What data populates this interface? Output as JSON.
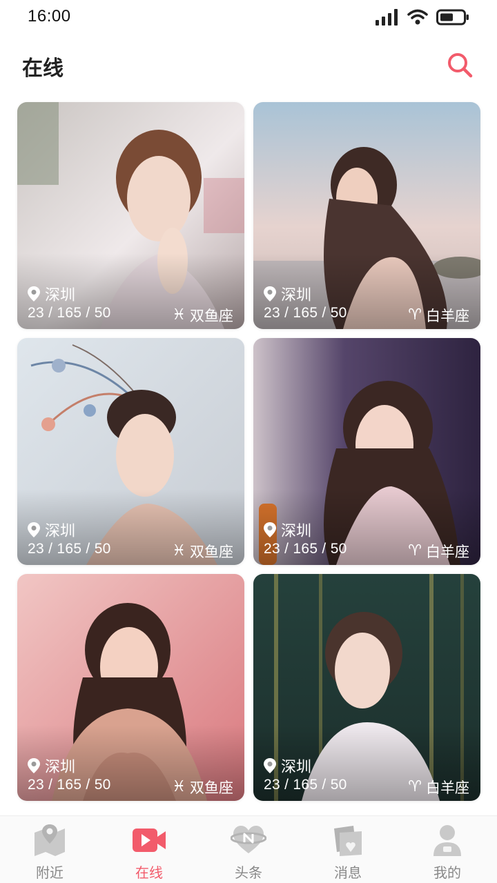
{
  "status_bar": {
    "time": "16:00"
  },
  "header": {
    "title": "在线"
  },
  "colors": {
    "accent": "#f25b6b",
    "inactive_icon": "#c9c9c9",
    "inactive_label": "#888888"
  },
  "cards": [
    {
      "location": "深圳",
      "stats": "23 / 165 / 50",
      "zodiac_icon": "pisces-icon",
      "zodiac_symbol": "♓",
      "zodiac": "双鱼座"
    },
    {
      "location": "深圳",
      "stats": "23 / 165 / 50",
      "zodiac_icon": "aries-icon",
      "zodiac_symbol": "♈",
      "zodiac": "白羊座"
    },
    {
      "location": "深圳",
      "stats": "23 / 165 / 50",
      "zodiac_icon": "pisces-icon",
      "zodiac_symbol": "♓",
      "zodiac": "双鱼座"
    },
    {
      "location": "深圳",
      "stats": "23 / 165 / 50",
      "zodiac_icon": "aries-icon",
      "zodiac_symbol": "♈",
      "zodiac": "白羊座"
    },
    {
      "location": "深圳",
      "stats": "23 / 165 / 50",
      "zodiac_icon": "pisces-icon",
      "zodiac_symbol": "♓",
      "zodiac": "双鱼座"
    },
    {
      "location": "深圳",
      "stats": "23 / 165 / 50",
      "zodiac_icon": "aries-icon",
      "zodiac_symbol": "♈",
      "zodiac": "白羊座"
    }
  ],
  "bottom_nav": {
    "active_index": 1,
    "items": [
      {
        "label": "附近",
        "icon": "map-icon"
      },
      {
        "label": "在线",
        "icon": "video-camera-icon"
      },
      {
        "label": "头条",
        "icon": "heart-news-icon"
      },
      {
        "label": "消息",
        "icon": "photo-message-icon"
      },
      {
        "label": "我的",
        "icon": "profile-icon"
      }
    ]
  }
}
